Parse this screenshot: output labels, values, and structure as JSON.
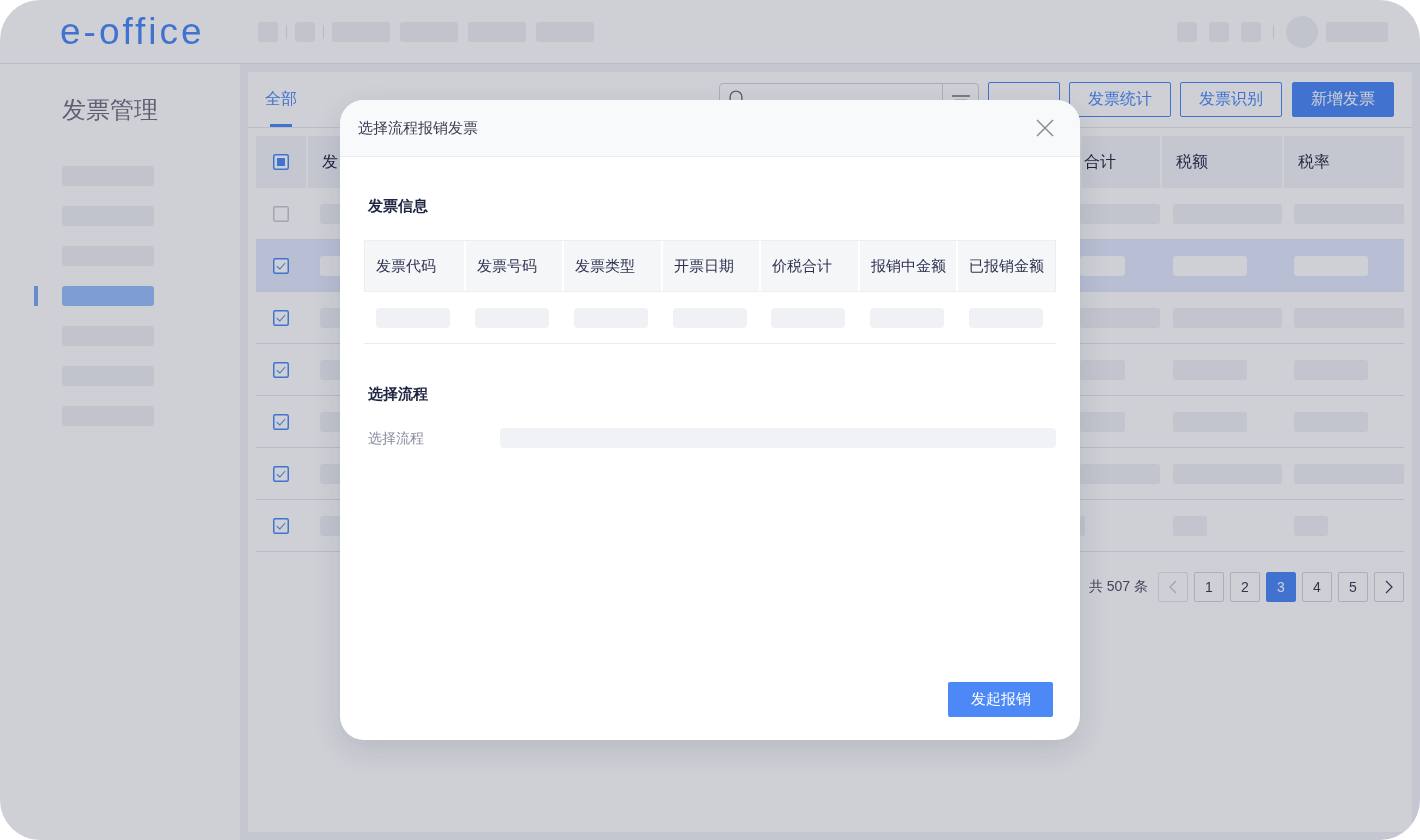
{
  "header": {
    "logo": "e-office"
  },
  "sidebar": {
    "title": "发票管理",
    "items": [
      {
        "selected": false
      },
      {
        "selected": false
      },
      {
        "selected": false
      },
      {
        "selected": true
      },
      {
        "selected": false
      },
      {
        "selected": false
      },
      {
        "selected": false
      }
    ]
  },
  "tabs": [
    {
      "label": "全部",
      "selected": true
    }
  ],
  "toolbar": {
    "buttons": [
      {
        "kind": "outline"
      },
      {
        "label": "发票统计",
        "kind": "outline"
      },
      {
        "label": "发票识别",
        "kind": "outline"
      },
      {
        "label": "新增发票",
        "kind": "primary"
      }
    ]
  },
  "table": {
    "select_all": {
      "indeterminate": true
    },
    "columns": [
      {
        "label": "发"
      },
      {
        "label": "合计"
      },
      {
        "label": "税额"
      },
      {
        "label": "税率"
      }
    ],
    "rows": [
      {
        "kind": "long",
        "checked": false,
        "selected": false
      },
      {
        "kind": "short",
        "checked": true,
        "selected": true
      },
      {
        "kind": "long",
        "checked": true,
        "selected": false
      },
      {
        "kind": "short",
        "checked": true,
        "selected": false
      },
      {
        "kind": "short",
        "checked": true,
        "selected": false
      },
      {
        "kind": "long",
        "checked": true,
        "selected": false
      },
      {
        "kind": "tiny",
        "checked": true,
        "selected": false
      }
    ]
  },
  "pagination": {
    "total": "共 507 条",
    "prev": {
      "disabled": true
    },
    "pages": [
      {
        "label": "1",
        "selected": false
      },
      {
        "label": "2",
        "selected": false
      },
      {
        "label": "3",
        "selected": true
      },
      {
        "label": "4",
        "selected": false
      },
      {
        "label": "5",
        "selected": false
      }
    ],
    "next": {
      "disabled": false
    }
  },
  "modal": {
    "title": "选择流程报销发票",
    "sections": [
      {
        "kind": "table",
        "title": "发票信息",
        "columns": [
          "发票代码",
          "发票号码",
          "发票类型",
          "开票日期",
          "价税合计",
          "报销中金额",
          "已报销金额"
        ]
      },
      {
        "kind": "form",
        "title": "选择流程",
        "fields": [
          {
            "label": "选择流程"
          }
        ]
      }
    ],
    "submit": "发起报销"
  }
}
